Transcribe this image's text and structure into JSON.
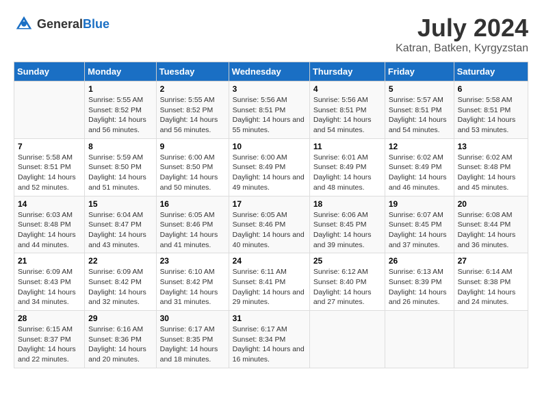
{
  "logo": {
    "general": "General",
    "blue": "Blue"
  },
  "header": {
    "month": "July 2024",
    "location": "Katran, Batken, Kyrgyzstan"
  },
  "days_of_week": [
    "Sunday",
    "Monday",
    "Tuesday",
    "Wednesday",
    "Thursday",
    "Friday",
    "Saturday"
  ],
  "weeks": [
    [
      {
        "day": "",
        "sunrise": "",
        "sunset": "",
        "daylight": ""
      },
      {
        "day": "1",
        "sunrise": "Sunrise: 5:55 AM",
        "sunset": "Sunset: 8:52 PM",
        "daylight": "Daylight: 14 hours and 56 minutes."
      },
      {
        "day": "2",
        "sunrise": "Sunrise: 5:55 AM",
        "sunset": "Sunset: 8:52 PM",
        "daylight": "Daylight: 14 hours and 56 minutes."
      },
      {
        "day": "3",
        "sunrise": "Sunrise: 5:56 AM",
        "sunset": "Sunset: 8:51 PM",
        "daylight": "Daylight: 14 hours and 55 minutes."
      },
      {
        "day": "4",
        "sunrise": "Sunrise: 5:56 AM",
        "sunset": "Sunset: 8:51 PM",
        "daylight": "Daylight: 14 hours and 54 minutes."
      },
      {
        "day": "5",
        "sunrise": "Sunrise: 5:57 AM",
        "sunset": "Sunset: 8:51 PM",
        "daylight": "Daylight: 14 hours and 54 minutes."
      },
      {
        "day": "6",
        "sunrise": "Sunrise: 5:58 AM",
        "sunset": "Sunset: 8:51 PM",
        "daylight": "Daylight: 14 hours and 53 minutes."
      }
    ],
    [
      {
        "day": "7",
        "sunrise": "Sunrise: 5:58 AM",
        "sunset": "Sunset: 8:51 PM",
        "daylight": "Daylight: 14 hours and 52 minutes."
      },
      {
        "day": "8",
        "sunrise": "Sunrise: 5:59 AM",
        "sunset": "Sunset: 8:50 PM",
        "daylight": "Daylight: 14 hours and 51 minutes."
      },
      {
        "day": "9",
        "sunrise": "Sunrise: 6:00 AM",
        "sunset": "Sunset: 8:50 PM",
        "daylight": "Daylight: 14 hours and 50 minutes."
      },
      {
        "day": "10",
        "sunrise": "Sunrise: 6:00 AM",
        "sunset": "Sunset: 8:49 PM",
        "daylight": "Daylight: 14 hours and 49 minutes."
      },
      {
        "day": "11",
        "sunrise": "Sunrise: 6:01 AM",
        "sunset": "Sunset: 8:49 PM",
        "daylight": "Daylight: 14 hours and 48 minutes."
      },
      {
        "day": "12",
        "sunrise": "Sunrise: 6:02 AM",
        "sunset": "Sunset: 8:49 PM",
        "daylight": "Daylight: 14 hours and 46 minutes."
      },
      {
        "day": "13",
        "sunrise": "Sunrise: 6:02 AM",
        "sunset": "Sunset: 8:48 PM",
        "daylight": "Daylight: 14 hours and 45 minutes."
      }
    ],
    [
      {
        "day": "14",
        "sunrise": "Sunrise: 6:03 AM",
        "sunset": "Sunset: 8:48 PM",
        "daylight": "Daylight: 14 hours and 44 minutes."
      },
      {
        "day": "15",
        "sunrise": "Sunrise: 6:04 AM",
        "sunset": "Sunset: 8:47 PM",
        "daylight": "Daylight: 14 hours and 43 minutes."
      },
      {
        "day": "16",
        "sunrise": "Sunrise: 6:05 AM",
        "sunset": "Sunset: 8:46 PM",
        "daylight": "Daylight: 14 hours and 41 minutes."
      },
      {
        "day": "17",
        "sunrise": "Sunrise: 6:05 AM",
        "sunset": "Sunset: 8:46 PM",
        "daylight": "Daylight: 14 hours and 40 minutes."
      },
      {
        "day": "18",
        "sunrise": "Sunrise: 6:06 AM",
        "sunset": "Sunset: 8:45 PM",
        "daylight": "Daylight: 14 hours and 39 minutes."
      },
      {
        "day": "19",
        "sunrise": "Sunrise: 6:07 AM",
        "sunset": "Sunset: 8:45 PM",
        "daylight": "Daylight: 14 hours and 37 minutes."
      },
      {
        "day": "20",
        "sunrise": "Sunrise: 6:08 AM",
        "sunset": "Sunset: 8:44 PM",
        "daylight": "Daylight: 14 hours and 36 minutes."
      }
    ],
    [
      {
        "day": "21",
        "sunrise": "Sunrise: 6:09 AM",
        "sunset": "Sunset: 8:43 PM",
        "daylight": "Daylight: 14 hours and 34 minutes."
      },
      {
        "day": "22",
        "sunrise": "Sunrise: 6:09 AM",
        "sunset": "Sunset: 8:42 PM",
        "daylight": "Daylight: 14 hours and 32 minutes."
      },
      {
        "day": "23",
        "sunrise": "Sunrise: 6:10 AM",
        "sunset": "Sunset: 8:42 PM",
        "daylight": "Daylight: 14 hours and 31 minutes."
      },
      {
        "day": "24",
        "sunrise": "Sunrise: 6:11 AM",
        "sunset": "Sunset: 8:41 PM",
        "daylight": "Daylight: 14 hours and 29 minutes."
      },
      {
        "day": "25",
        "sunrise": "Sunrise: 6:12 AM",
        "sunset": "Sunset: 8:40 PM",
        "daylight": "Daylight: 14 hours and 27 minutes."
      },
      {
        "day": "26",
        "sunrise": "Sunrise: 6:13 AM",
        "sunset": "Sunset: 8:39 PM",
        "daylight": "Daylight: 14 hours and 26 minutes."
      },
      {
        "day": "27",
        "sunrise": "Sunrise: 6:14 AM",
        "sunset": "Sunset: 8:38 PM",
        "daylight": "Daylight: 14 hours and 24 minutes."
      }
    ],
    [
      {
        "day": "28",
        "sunrise": "Sunrise: 6:15 AM",
        "sunset": "Sunset: 8:37 PM",
        "daylight": "Daylight: 14 hours and 22 minutes."
      },
      {
        "day": "29",
        "sunrise": "Sunrise: 6:16 AM",
        "sunset": "Sunset: 8:36 PM",
        "daylight": "Daylight: 14 hours and 20 minutes."
      },
      {
        "day": "30",
        "sunrise": "Sunrise: 6:17 AM",
        "sunset": "Sunset: 8:35 PM",
        "daylight": "Daylight: 14 hours and 18 minutes."
      },
      {
        "day": "31",
        "sunrise": "Sunrise: 6:17 AM",
        "sunset": "Sunset: 8:34 PM",
        "daylight": "Daylight: 14 hours and 16 minutes."
      },
      {
        "day": "",
        "sunrise": "",
        "sunset": "",
        "daylight": ""
      },
      {
        "day": "",
        "sunrise": "",
        "sunset": "",
        "daylight": ""
      },
      {
        "day": "",
        "sunrise": "",
        "sunset": "",
        "daylight": ""
      }
    ]
  ]
}
